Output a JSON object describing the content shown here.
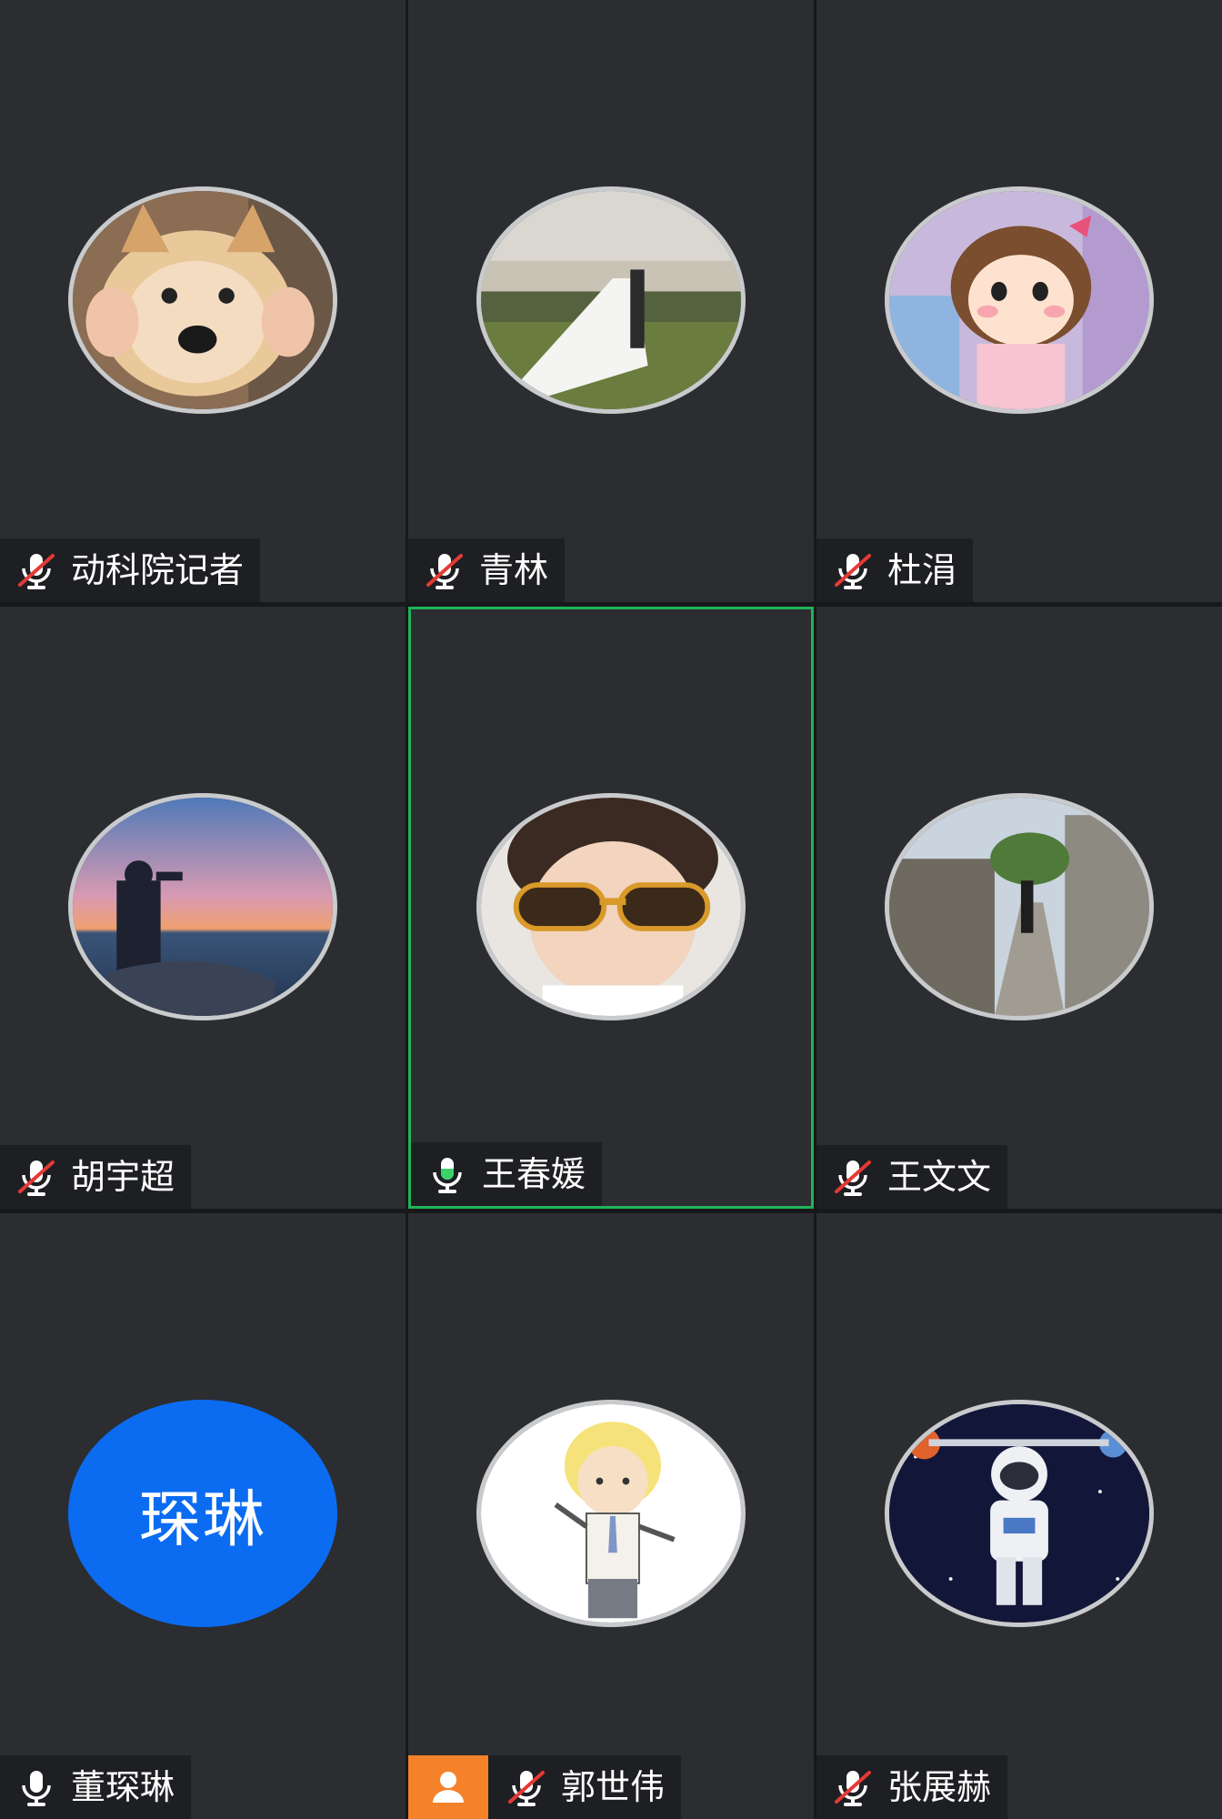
{
  "participants": [
    {
      "name": "动科院记者",
      "mic": "muted",
      "avatar": "shiba-bread-photo"
    },
    {
      "name": "青林",
      "mic": "muted",
      "avatar": "wedding-photo"
    },
    {
      "name": "杜涓",
      "mic": "muted",
      "avatar": "cartoon-girl"
    },
    {
      "name": "胡宇超",
      "mic": "muted",
      "avatar": "sunset-sea-photo"
    },
    {
      "name": "王春媛",
      "mic": "active",
      "avatar": "child-sunglasses-photo",
      "speaking": true
    },
    {
      "name": "王文文",
      "mic": "muted",
      "avatar": "old-wall-street-photo"
    },
    {
      "name": "董琛琳",
      "mic": "on",
      "avatar_text": "琛琳",
      "avatar": "text"
    },
    {
      "name": "郭世伟",
      "mic": "muted",
      "avatar": "cartoon-boy",
      "host": true
    },
    {
      "name": "张展赫",
      "mic": "muted",
      "avatar": "astronaut-cartoon"
    }
  ],
  "colors": {
    "tile_bg": "#2b2d31",
    "active_border": "#1fb457",
    "mic_active": "#3bd26a",
    "mute_slash": "#e53935",
    "text_avatar_bg": "#0b6cf2",
    "host_badge": "#f5822a"
  }
}
